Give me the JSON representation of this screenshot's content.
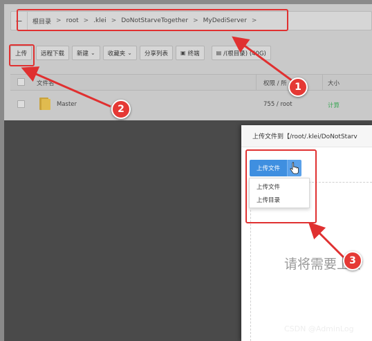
{
  "breadcrumb": {
    "back_icon": "back-arrow-icon",
    "items": [
      {
        "label": "根目录"
      },
      {
        "label": "root"
      },
      {
        "label": ".klei"
      },
      {
        "label": "DoNotStarveTogether"
      },
      {
        "label": "MyDediServer"
      }
    ],
    "separator": ">"
  },
  "toolbar": {
    "upload": "上传",
    "remote_download": "远程下载",
    "new": "新建",
    "favorites": "收藏夹",
    "share_list": "分享列表",
    "terminal": "终端",
    "disk": "/(根目录) (40G)"
  },
  "table": {
    "headers": {
      "name": "文件名",
      "permission": "权限 / 所",
      "size": "大小"
    },
    "rows": [
      {
        "name": "Master",
        "permission": "755 / root",
        "size": "计算"
      }
    ]
  },
  "modal": {
    "title": "上传文件到【/root/.klei/DoNotStarv",
    "upload_file_button": "上传文件",
    "menu": [
      "上传文件",
      "上传目录"
    ],
    "drop_hint": "请将需要上传"
  },
  "annotations": [
    "1",
    "2",
    "3"
  ],
  "watermark": "CSDN @AdminLog",
  "colors": {
    "accent_blue": "#3f8fe0",
    "annotation_red": "#e03030",
    "size_link_green": "#3aa655",
    "folder_yellow": "#e0bb4f"
  }
}
